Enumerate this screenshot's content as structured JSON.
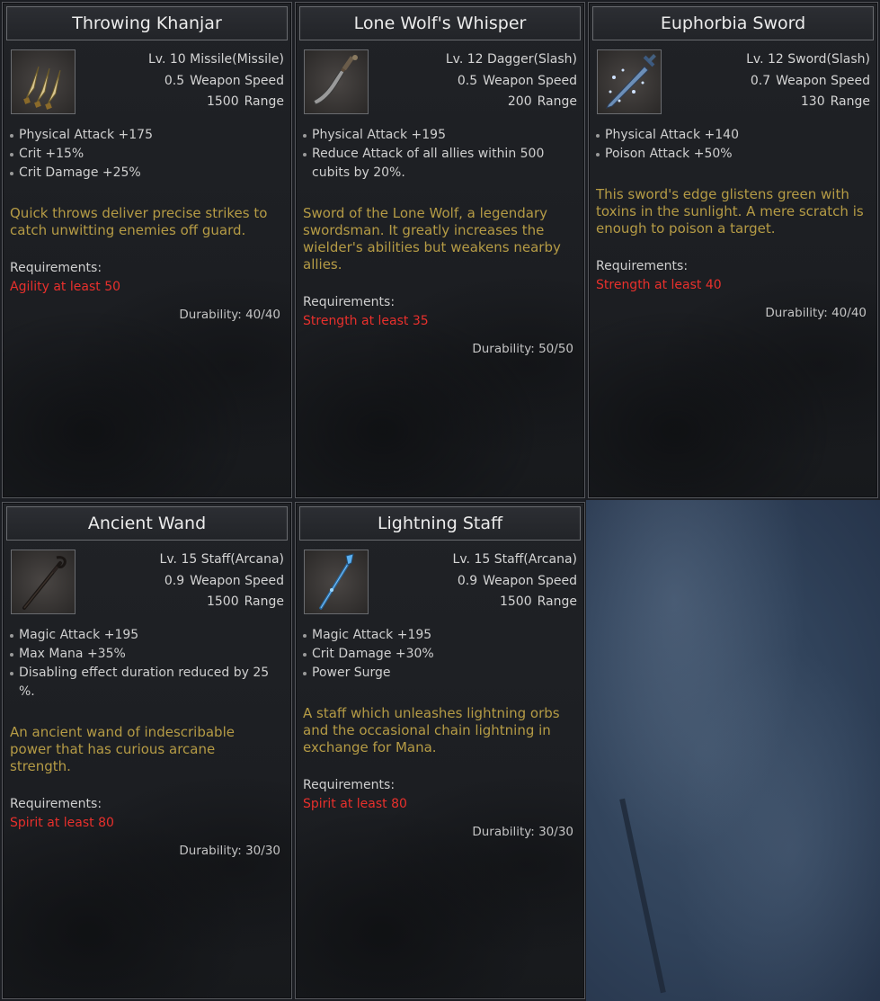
{
  "items": [
    {
      "name": "Throwing Khanjar",
      "level_type": "Lv. 10 Missile(Missile)",
      "weapon_speed_value": "0.5",
      "weapon_speed_label": "Weapon Speed",
      "range_value": "1500",
      "range_label": "Range",
      "icon": "throwing-knives-icon",
      "properties": [
        "Physical Attack +175",
        "Crit +15%",
        "Crit Damage +25%"
      ],
      "description": "Quick throws deliver precise strikes to catch unwitting enemies off guard.",
      "requirements_label": "Requirements:",
      "requirement": "Agility at least 50",
      "durability": "Durability: 40/40"
    },
    {
      "name": "Lone Wolf's Whisper",
      "level_type": "Lv. 12 Dagger(Slash)",
      "weapon_speed_value": "0.5",
      "weapon_speed_label": "Weapon Speed",
      "range_value": "200",
      "range_label": "Range",
      "icon": "curved-dagger-icon",
      "properties": [
        "Physical Attack +195",
        "Reduce Attack of all allies within 500 cubits by 20%."
      ],
      "description": "Sword of the Lone Wolf, a legendary swordsman. It greatly increases the wielder's abilities but weakens nearby allies.",
      "requirements_label": "Requirements:",
      "requirement": "Strength at least 35",
      "durability": "Durability: 50/50"
    },
    {
      "name": "Euphorbia Sword",
      "level_type": "Lv. 12 Sword(Slash)",
      "weapon_speed_value": "0.7",
      "weapon_speed_label": "Weapon Speed",
      "range_value": "130",
      "range_label": "Range",
      "icon": "frost-sword-icon",
      "properties": [
        "Physical Attack +140",
        "Poison Attack +50%"
      ],
      "description": "This sword's edge glistens green with toxins in the sunlight. A mere scratch is enough to poison a target.",
      "requirements_label": "Requirements:",
      "requirement": "Strength at least 40",
      "durability": "Durability: 40/40"
    },
    {
      "name": "Ancient Wand",
      "level_type": "Lv. 15 Staff(Arcana)",
      "weapon_speed_value": "0.9",
      "weapon_speed_label": "Weapon Speed",
      "range_value": "1500",
      "range_label": "Range",
      "icon": "dark-wand-icon",
      "properties": [
        "Magic Attack +195",
        "Max Mana +35%",
        "Disabling effect duration reduced by 25 %."
      ],
      "description": "An ancient wand of indescribable power that has curious arcane strength.",
      "requirements_label": "Requirements:",
      "requirement": "Spirit at least 80",
      "durability": "Durability: 30/30"
    },
    {
      "name": "Lightning Staff",
      "level_type": "Lv. 15 Staff(Arcana)",
      "weapon_speed_value": "0.9",
      "weapon_speed_label": "Weapon Speed",
      "range_value": "1500",
      "range_label": "Range",
      "icon": "lightning-staff-icon",
      "properties": [
        "Magic Attack +195",
        "Crit Damage +30%",
        "Power Surge"
      ],
      "description": "A staff which unleashes lightning orbs and the occasional chain lightning in exchange for Mana.",
      "requirements_label": "Requirements:",
      "requirement": "Spirit at least 80",
      "durability": "Durability: 30/30"
    }
  ],
  "colors": {
    "title_text": "#ececec",
    "description_text": "#b59b45",
    "requirement_text": "#e8302c",
    "property_text": "#cfcfcf"
  }
}
